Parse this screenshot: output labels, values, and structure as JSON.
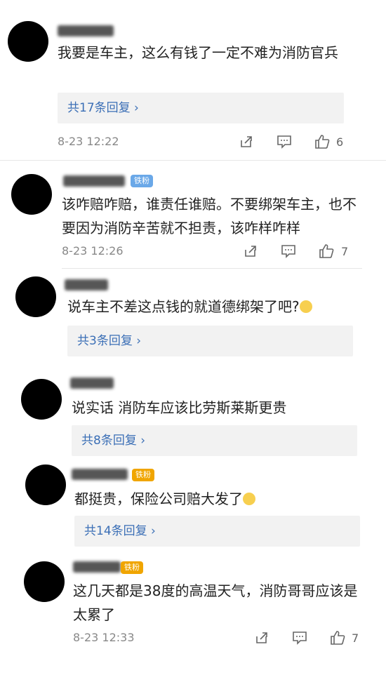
{
  "comments": [
    {
      "text": "我要是车主，这么有钱了一定不难为消防官兵",
      "reply": "共17条回复 ›",
      "time": "8-23 12:22",
      "likes": "6"
    },
    {
      "badge": "铁粉",
      "text": "该咋赔咋赔，谁责任谁赔。不要绑架车主，也不要因为消防辛苦就不担责，该咋样咋样",
      "time": "8-23 12:26",
      "likes": "7"
    },
    {
      "text": "说车主不差这点钱的就道德绑架了吧?",
      "reply": "共3条回复 ›"
    },
    {
      "text": "说实话 消防车应该比劳斯莱斯更贵",
      "reply": "共8条回复 ›"
    },
    {
      "badge": "铁粉",
      "text": "都挺贵，保险公司赔大发了",
      "reply": "共14条回复 ›"
    },
    {
      "badge": "铁粉",
      "text": "这几天都是38度的高温天气，消防哥哥应该是太累了",
      "time": "8-23 12:33",
      "likes": "7"
    }
  ],
  "icons": {
    "share": "share-icon",
    "comment": "comment-icon",
    "like": "thumbs-up-icon"
  }
}
